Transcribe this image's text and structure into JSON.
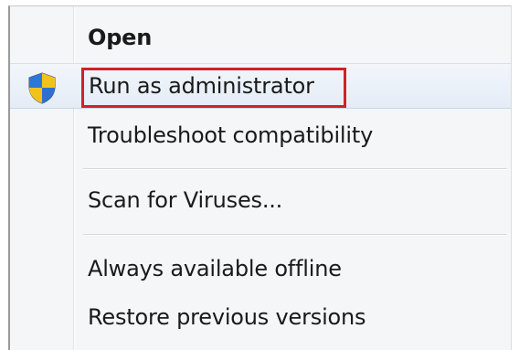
{
  "context_menu": {
    "items": [
      {
        "label": "Open"
      },
      {
        "label": "Run as administrator"
      },
      {
        "label": "Troubleshoot compatibility"
      },
      {
        "label": "Scan for Viruses..."
      },
      {
        "label": "Always available offline"
      },
      {
        "label": "Restore previous versions"
      }
    ],
    "highlight_color": "#d2202a",
    "hover_color": "#e4ecf6",
    "shield_icon": "uac-shield-icon"
  }
}
